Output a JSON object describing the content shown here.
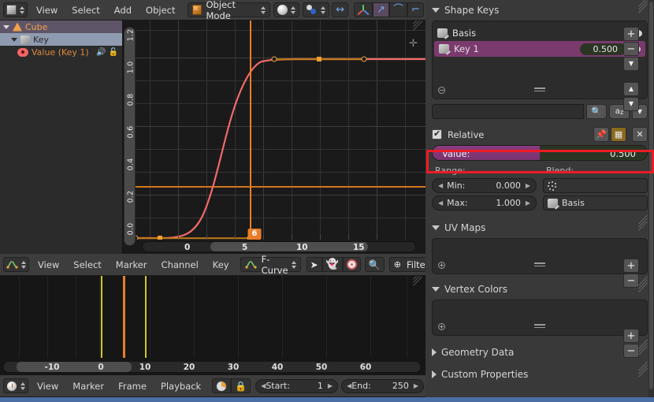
{
  "topbar": {
    "editor_type_icon": "object-mode-editor-icon",
    "menus": [
      "View",
      "Select",
      "Add",
      "Object"
    ],
    "mode_selector": {
      "label": "Object Mode",
      "icon": "cube-icon"
    },
    "shading_icon": "shading-sphere-icon",
    "snap_icon": "snap-magnet-icon",
    "proportional_icon": "proportional-edit-icon",
    "manipulator_translate_icon": "manipulator-axis-icon",
    "manipulator_rotate_icon": "manipulator-arrow-icon",
    "manipulator_curve_icon": "manipulator-rotate-icon",
    "manipulator_scale_icon": "manipulator-scale-icon"
  },
  "channels": [
    {
      "label": "Cube",
      "icon": "mesh-triangle-icon",
      "level": 0,
      "expanded": true
    },
    {
      "label": "Key",
      "icon": "shapekey-object-icon",
      "level": 1,
      "expanded": true
    },
    {
      "label": "Value (Key 1)",
      "icon": "eye-icon",
      "level": 2,
      "expanded": false,
      "speaker_icon": "speaker-icon",
      "lock_icon": "unlocked-icon"
    }
  ],
  "graph": {
    "y_ticks": [
      "1.2",
      "1.0",
      "0.8",
      "0.6",
      "0.4",
      "0.2",
      "0.0"
    ],
    "x_ticks": [
      "0",
      "5",
      "10",
      "15"
    ],
    "current_frame": "6",
    "value_line": 0.3,
    "keyframes": [
      {
        "frame": 1,
        "value": 0.0,
        "selected": false
      },
      {
        "frame": 11,
        "value": 1.0,
        "selected": false
      }
    ],
    "handles": [
      {
        "frame": -1.4,
        "value": 0.0
      },
      {
        "frame": 3.7,
        "value": 0.0
      },
      {
        "frame": 7.8,
        "value": 1.0
      },
      {
        "frame": 15.3,
        "value": 1.0
      }
    ],
    "curve_color": "#f06a6a",
    "handle_color": "#d8881f",
    "playhead_color": "#ea7d2a",
    "add_marker_icon": "plus-icon"
  },
  "dopesheet_header": {
    "editor_type_icon": "graph-editor-icon",
    "menus": [
      "View",
      "Select",
      "Marker",
      "Channel",
      "Key"
    ],
    "mode_selector": {
      "label": "F-Curve",
      "icon": "fcurve-icon"
    },
    "cursor_icon": "cursor-arrow-icon",
    "ghost_icon": "ghost-curves-icon",
    "proportional_icon": "proportional-edit-icon",
    "normalize_icon": "magnifier-icon",
    "filters_label": "Filters",
    "filters_icon": "filter-gear-icon"
  },
  "dopesheet": {
    "x_ticks": [
      "-10",
      "0",
      "10",
      "20",
      "30",
      "40",
      "50",
      "60"
    ],
    "keyframe_marks": [
      {
        "frame": 1,
        "color": "#cfc62a"
      },
      {
        "frame": 6,
        "color": "#ea7d2a"
      },
      {
        "frame": 11,
        "color": "#cfc62a"
      }
    ]
  },
  "timeline_footer": {
    "editor_type_icon": "timeline-editor-icon",
    "menus": [
      "View",
      "Marker",
      "Frame",
      "Playback"
    ],
    "sync_icon": "sync-range-icon",
    "lock_icon": "lock-icon",
    "start": {
      "label": "Start:",
      "value": "1"
    },
    "end": {
      "label": "End:",
      "value": "250"
    }
  },
  "properties": {
    "shape_keys": {
      "title": "Shape Keys",
      "expanded": true,
      "keys": [
        {
          "name": "Basis",
          "value": null,
          "selected": false,
          "icon": "shapekey-icon",
          "visibility_icon": "eye-icon"
        },
        {
          "name": "Key 1",
          "value": "0.500",
          "selected": true,
          "icon": "shapekey-icon",
          "visibility_icon": "eye-icon"
        }
      ],
      "side_buttons": [
        {
          "name": "add-shape-key",
          "glyph": "+"
        },
        {
          "name": "remove-shape-key",
          "glyph": "−"
        },
        {
          "name": "shape-key-specials",
          "glyph": "▼"
        },
        {
          "name": "move-shape-key-up",
          "glyph": "▲"
        },
        {
          "name": "move-shape-key-down",
          "glyph": "▼"
        }
      ],
      "search": {
        "placeholder": "",
        "value": "",
        "search_icon": "magnifier-icon",
        "sort_icon": "sort-alpha-icon",
        "dropdown_icon": "chevron-down-icon"
      }
    },
    "relative": {
      "label": "Relative",
      "checked": true,
      "pin_icon": "pin-icon",
      "datablock_icon": "datablock-icon",
      "close_icon": "close-x-icon"
    },
    "value": {
      "label": "Value:",
      "value": "0.500",
      "fill_ratio": 0.5,
      "highlight_color": "#ee1b24"
    },
    "range": {
      "label": "Range:",
      "min": {
        "label": "Min:",
        "value": "0.000"
      },
      "max": {
        "label": "Max:",
        "value": "1.000"
      }
    },
    "blend": {
      "label": "Blend:",
      "vertex_group": {
        "value": "",
        "icon": "vertex-group-icon"
      },
      "relative_key": {
        "value": "Basis",
        "icon": "shapekey-icon"
      }
    },
    "uv_maps": {
      "title": "UV Maps",
      "expanded": true,
      "add_glyph": "+",
      "remove_glyph": "−"
    },
    "vertex_colors": {
      "title": "Vertex Colors",
      "expanded": true,
      "add_glyph": "+",
      "remove_glyph": "−"
    },
    "geometry_data": {
      "title": "Geometry Data",
      "expanded": false
    },
    "custom_props": {
      "title": "Custom Properties",
      "expanded": false
    }
  },
  "colors": {
    "accent_orange": "#ea7d2a",
    "selection_purple": "#7b3a6e",
    "highlight_red": "#ee1b24",
    "status_blue": "#4a6fa5"
  }
}
